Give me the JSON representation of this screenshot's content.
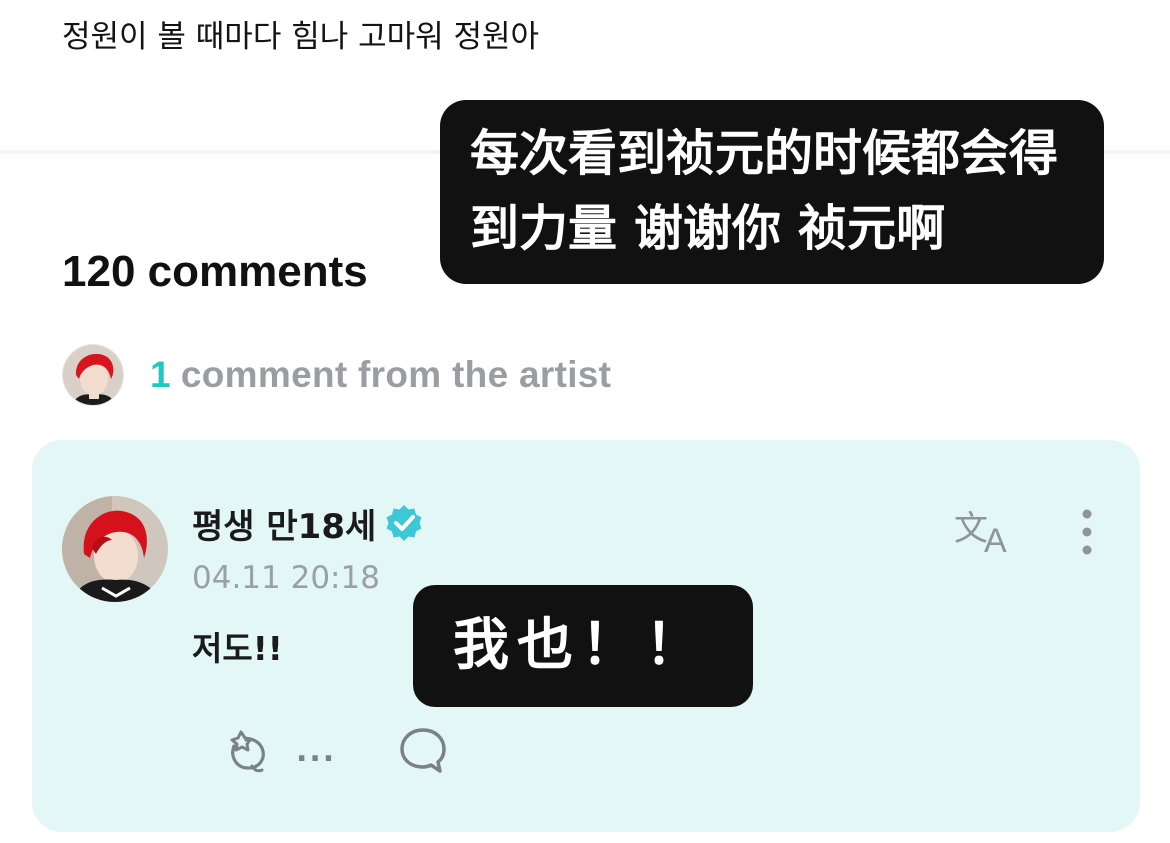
{
  "post": {
    "text": "정원이 볼 때마다 힘나 고마워 정원아"
  },
  "comments_header": {
    "count_label": "120 comments"
  },
  "artist_comments": {
    "count": "1",
    "label": "comment from the artist"
  },
  "comment": {
    "author": "평생 만18세",
    "verified": true,
    "timestamp": "04.11 20:18",
    "body": "저도!!",
    "like_count": "...",
    "icons": {
      "translate": "translate-icon",
      "more": "more-vertical-icon",
      "like": "like-icon",
      "reply": "reply-bubble-icon",
      "verified": "verified-badge-icon"
    }
  },
  "overlays": {
    "top_caption": "每次看到祯元的时候都会得到力量 谢谢你 祯元啊",
    "mid_caption": "我也！！"
  },
  "colors": {
    "accent": "#23c7c1",
    "card_background": "#e3f8f6",
    "verified_badge": "#3dc8d6",
    "muted_text": "#9aa0a6",
    "overlay_background": "#111111"
  }
}
